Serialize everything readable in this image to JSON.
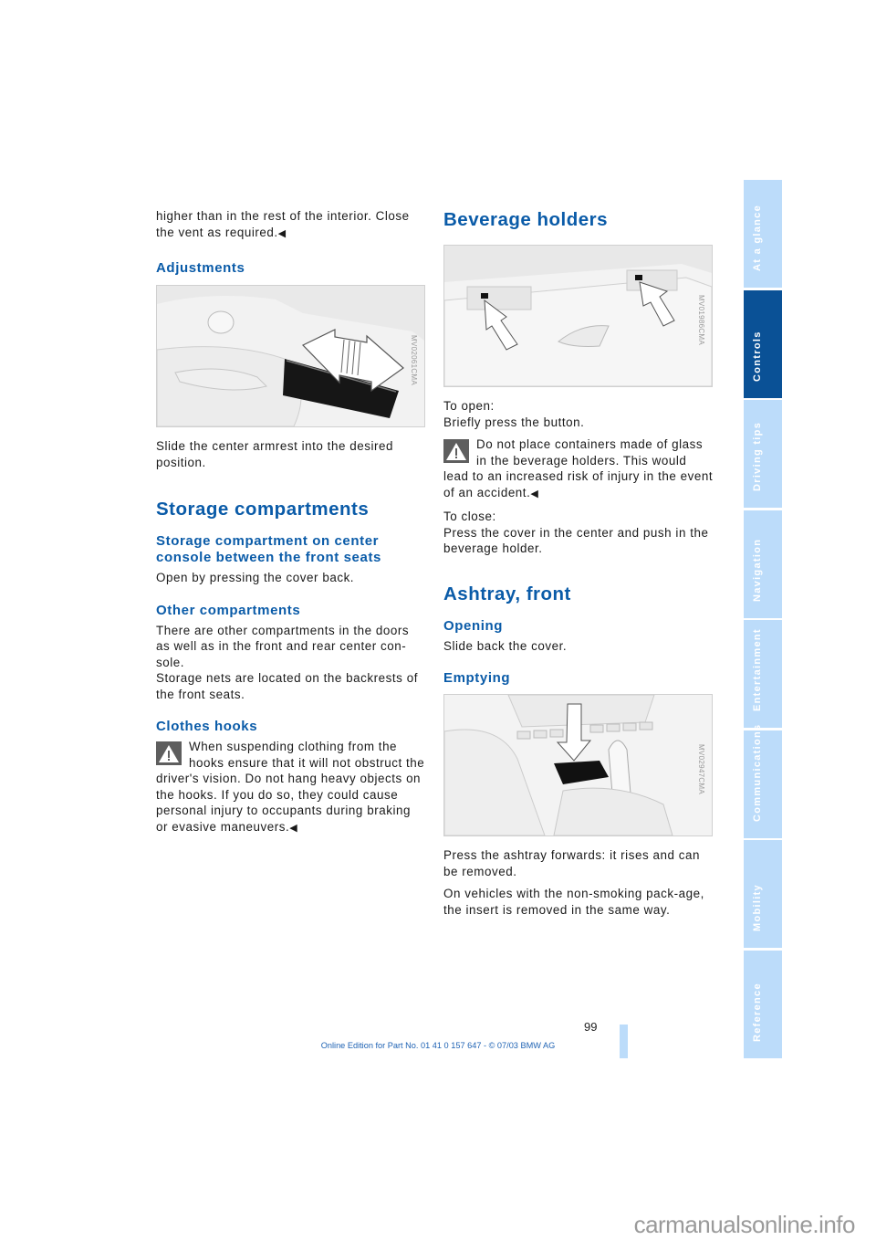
{
  "left_column": {
    "intro_paragraph": "higher than in the rest of the interior. Close the vent as required.",
    "adjustments": {
      "heading": "Adjustments",
      "figure_code": "MV02061CMA",
      "text": "Slide the center armrest into the desired position."
    },
    "storage": {
      "heading": "Storage compartments",
      "center_console": {
        "heading": "Storage compartment on center console between the front seats",
        "text": "Open by pressing the cover back."
      },
      "other": {
        "heading": "Other compartments",
        "text1": "There are other compartments in the doors as well as in the front and rear center con-sole.",
        "text2": "Storage nets are located on the backrests of the front seats."
      },
      "clothes_hooks": {
        "heading": "Clothes hooks",
        "warning": "When suspending clothing from the hooks ensure that it will not obstruct the driver's vision. Do not hang heavy objects on the hooks. If you do so, they could cause personal injury to occupants during braking or evasive maneuvers."
      }
    }
  },
  "right_column": {
    "beverage": {
      "heading": "Beverage holders",
      "figure_code": "MV01986CMA",
      "open_label": "To open:",
      "open_text": "Briefly press the button.",
      "warning": "Do not place containers made of glass in the beverage holders. This would lead to an increased risk of injury in the event of an accident.",
      "close_label": "To close:",
      "close_text": "Press the cover in the center and push in the beverage holder."
    },
    "ashtray": {
      "heading": "Ashtray, front",
      "opening_heading": "Opening",
      "opening_text": "Slide back the cover.",
      "emptying_heading": "Emptying",
      "figure_code": "MV02947CMA",
      "emptying_text": "Press the ashtray forwards: it rises and can be removed.",
      "nonsmoking_text": "On vehicles with the non-smoking pack-age, the insert is removed in the same way."
    }
  },
  "end_mark": "◀",
  "side_tabs": [
    {
      "label": "At a glance",
      "active": false
    },
    {
      "label": "Controls",
      "active": true
    },
    {
      "label": "Driving tips",
      "active": false
    },
    {
      "label": "Navigation",
      "active": false
    },
    {
      "label": "Entertainment",
      "active": false
    },
    {
      "label": "Communications",
      "active": false
    },
    {
      "label": "Mobility",
      "active": false
    },
    {
      "label": "Reference",
      "active": false
    }
  ],
  "colors": {
    "heading_blue": "#0a5ba8",
    "tab_active": "#0a5196",
    "tab_inactive": "#bcdcfa",
    "footer_blue": "#1f63b4"
  },
  "page_number": "99",
  "footer_text": "Online Edition for Part No. 01 41 0 157 647 - © 07/03 BMW AG",
  "watermark": "carmanualsonline.info"
}
